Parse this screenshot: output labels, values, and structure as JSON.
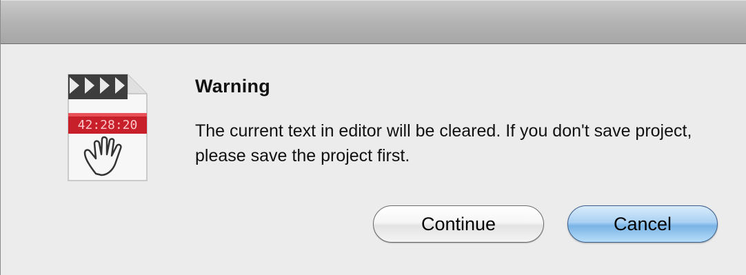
{
  "dialog": {
    "title": "Warning",
    "message": "The current text in editor will be cleared. If you don't save project, please save the project first.",
    "icon": "clapperboard-document-icon",
    "icon_display_text": "42:28:20",
    "buttons": {
      "continue_label": "Continue",
      "cancel_label": "Cancel"
    }
  },
  "colors": {
    "default_button": "#7ab4e6",
    "dialog_background": "#ececec",
    "icon_display_red": "#c8202a"
  }
}
